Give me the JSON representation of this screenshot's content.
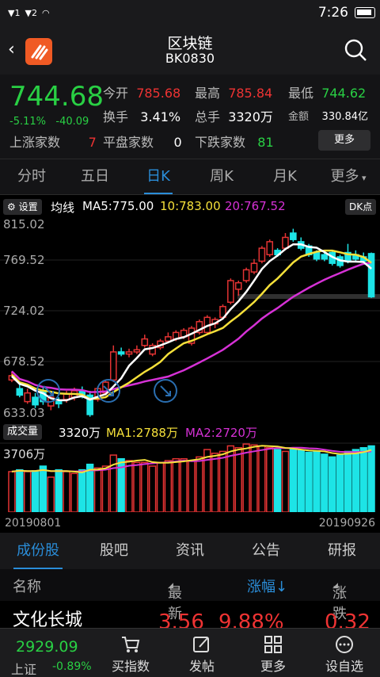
{
  "status": {
    "sim1": "1",
    "sim2": "2",
    "time": "7:26"
  },
  "header": {
    "title": "区块链",
    "code": "BK0830"
  },
  "quote": {
    "price": "744.68",
    "change_pct": "-5.11%",
    "change": "-40.09",
    "open_label": "今开",
    "open": "785.68",
    "high_label": "最高",
    "high": "785.84",
    "low_label": "最低",
    "low": "744.62",
    "turnover_label": "换手",
    "turnover": "3.41%",
    "volume_label": "总手",
    "volume": "3320万",
    "amount_label": "金额",
    "amount": "330.84亿",
    "up_label": "上涨家数",
    "up": "7",
    "flat_label": "平盘家数",
    "flat": "0",
    "down_label": "下跌家数",
    "down": "81",
    "more": "更多"
  },
  "period_tabs": [
    "分时",
    "五日",
    "日K",
    "周K",
    "月K",
    "更多"
  ],
  "ma": {
    "settings": "设置",
    "label": "均线",
    "ma5": "MA5:775.00",
    "ma10": "10:783.00",
    "ma20": "20:767.52",
    "dk": "DK点"
  },
  "kchart": {
    "ticks": [
      "815.02",
      "769.52",
      "724.02",
      "678.52",
      "633.03"
    ]
  },
  "volume": {
    "label": "成交量",
    "vol": "3320万",
    "ma1": "MA1:2788万",
    "ma2": "MA2:2720万",
    "max": "3706万"
  },
  "dates": {
    "start": "20190801",
    "end": "20190926"
  },
  "list_tabs": [
    "成份股",
    "股吧",
    "资讯",
    "公告",
    "研报"
  ],
  "table": {
    "name": "名称",
    "latest": "最新",
    "pct": "涨幅↓",
    "chg": "涨跌",
    "row_name": "文化长城",
    "row_latest": "3.56",
    "row_pct": "9.88%",
    "row_chg": "0.32"
  },
  "bottom_nav": {
    "index_value": "2929.09",
    "index_name": "上证",
    "index_pct": "-0.89%",
    "items": [
      "买指数",
      "发帖",
      "更多",
      "设自选"
    ]
  },
  "colors": {
    "up": "#e33333",
    "down": "#29d044",
    "ma5": "#ffffff",
    "ma10": "#f5e03a",
    "ma20": "#d631d6",
    "accent": "#2a8dd8",
    "cyan": "#1de4e6"
  }
}
